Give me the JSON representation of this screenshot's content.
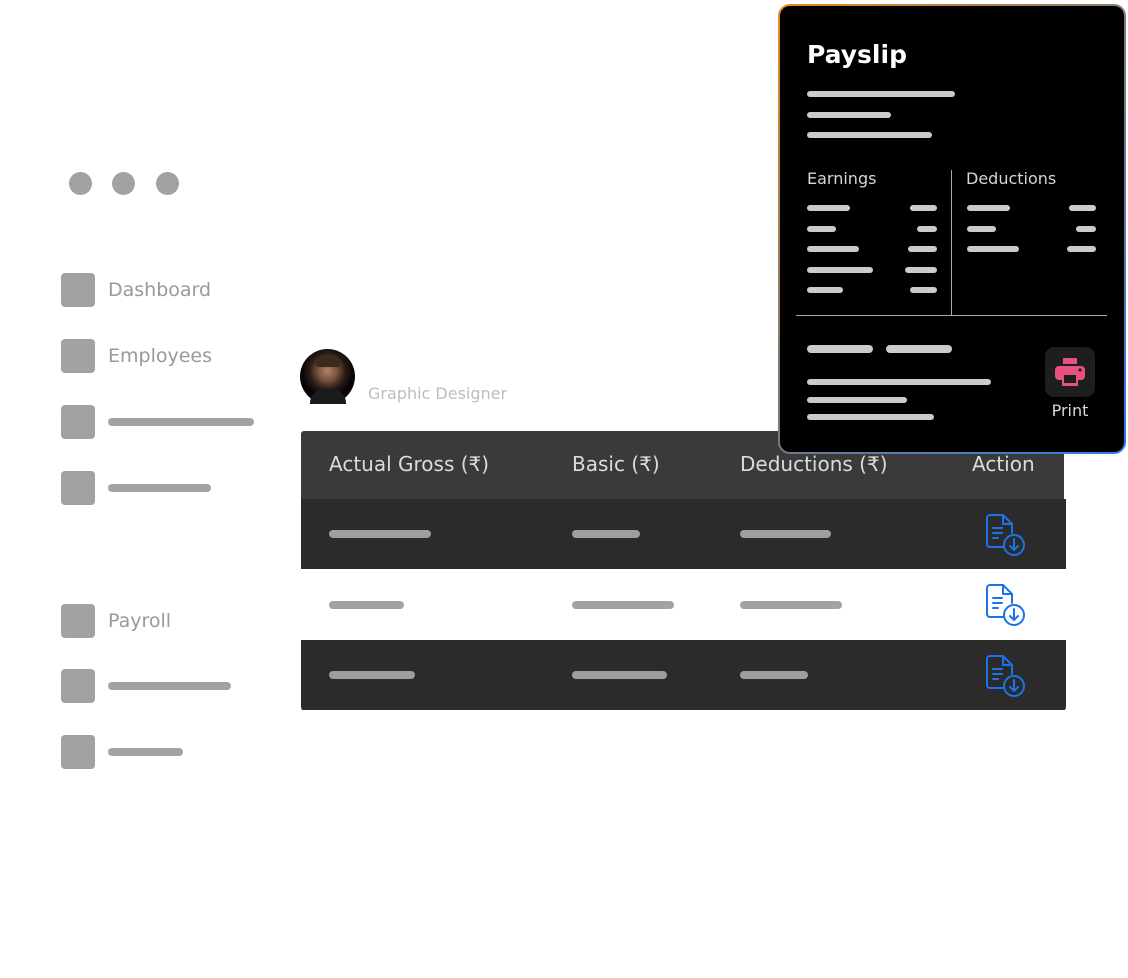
{
  "window": {
    "controls": [
      "dot",
      "dot",
      "dot"
    ]
  },
  "sidebar": {
    "items": [
      {
        "label": "Dashboard"
      },
      {
        "label": "Employees"
      },
      {
        "label": ""
      },
      {
        "label": ""
      },
      {
        "label": "Payroll"
      },
      {
        "label": ""
      },
      {
        "label": ""
      }
    ]
  },
  "profile": {
    "role": "Graphic Designer",
    "avatar": "user-avatar"
  },
  "table": {
    "headers": [
      "Actual Gross (₹)",
      "Basic (₹)",
      "Deductions (₹)",
      "Action"
    ],
    "rows": [
      {
        "action_icon": "download-document-icon"
      },
      {
        "action_icon": "download-document-icon"
      },
      {
        "action_icon": "download-document-icon"
      }
    ]
  },
  "payslip": {
    "title": "Payslip",
    "earnings_label": "Earnings",
    "deductions_label": "Deductions",
    "print_label": "Print",
    "print_icon": "printer-icon"
  },
  "colors": {
    "accent_blue": "#1a73e8",
    "print_pink": "#e8517e",
    "gradient_start": "#e8891f",
    "gradient_end": "#2f7de8"
  }
}
